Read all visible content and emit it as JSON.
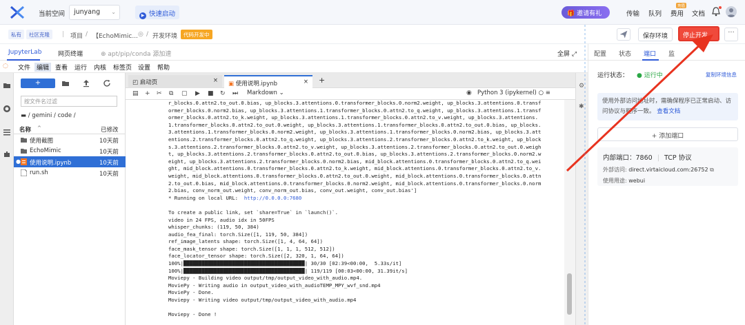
{
  "topbar": {
    "current_space_label": "当前空间",
    "space_value": "junyang",
    "quickstart_label": "快速启动",
    "invite_label": "邀请有礼",
    "nav": [
      "传输",
      "队列",
      "费用",
      "文档"
    ],
    "fee_badge": "充值"
  },
  "breadcrumb": {
    "tag_private": "私有",
    "tag_community": "社区克隆",
    "project": "项目",
    "name": "【EchoMimic...",
    "env": "开发环境",
    "dev_tag": "代码开发中",
    "save_env": "保存环境",
    "stop_dev": "停止开发",
    "more": "···"
  },
  "tabs": {
    "jupyter": "JupyterLab",
    "terminal": "网页终端",
    "conda": "apt/pip/conda 源加速",
    "fullscreen": "全屏"
  },
  "right_panel": {
    "tabs": [
      "配置",
      "状态",
      "端口",
      "监"
    ],
    "run_status_label": "运行状态：",
    "run_status_value": "● 运行中",
    "copy_env": "复制环境信息",
    "info_text": "使用外部访问地址时，需确保程序已正常启动、访问协议与程序一致。",
    "info_link": "查看文档",
    "add_port": "+ 添加端口",
    "port_label": "内部端口：",
    "port_value": "7860",
    "protocol": "TCP 协议",
    "ext_label": "外部访问:",
    "ext_value": "direct.virtaicloud.com:26752",
    "use_label": "使用用途:",
    "use_value": "webui"
  },
  "menubar": [
    "文件",
    "编辑",
    "查看",
    "运行",
    "内核",
    "标签页",
    "设置",
    "帮助"
  ],
  "filebrowser": {
    "filter_placeholder": "按文件名过滤",
    "path": "/ gemini / code /",
    "col_name": "名称",
    "col_modified": "已修改",
    "files": [
      {
        "name": "使用截图",
        "modified": "10天前",
        "type": "folder"
      },
      {
        "name": "EchoMimic",
        "modified": "10天前",
        "type": "folder"
      },
      {
        "name": "使用说明.ipynb",
        "modified": "10天前",
        "type": "notebook"
      },
      {
        "name": "run.sh",
        "modified": "10天前",
        "type": "file"
      }
    ]
  },
  "notebook": {
    "tab1": "启动页",
    "tab2": "使用说明.ipynb",
    "cell_type": "Markdown",
    "kernel": "Python 3 (ipykernel)",
    "output_lines": [
      "r_blocks.0.attn2.to_out.0.bias, up_blocks.3.attentions.0.transformer_blocks.0.norm2.weight, up_blocks.3.attentions.0.transf",
      "ormer_blocks.0.norm2.bias, up_blocks.3.attentions.1.transformer_blocks.0.attn2.to_q.weight, up_blocks.3.attentions.1.transf",
      "ormer_blocks.0.attn2.to_k.weight, up_blocks.3.attentions.1.transformer_blocks.0.attn2.to_v.weight, up_blocks.3.attentions.",
      "1.transformer_blocks.0.attn2.to_out.0.weight, up_blocks.3.attentions.1.transformer_blocks.0.attn2.to_out.0.bias, up_blocks.",
      "3.attentions.1.transformer_blocks.0.norm2.weight, up_blocks.3.attentions.1.transformer_blocks.0.norm2.bias, up_blocks.3.att",
      "entions.2.transformer_blocks.0.attn2.to_q.weight, up_blocks.3.attentions.2.transformer_blocks.0.attn2.to_k.weight, up_block",
      "s.3.attentions.2.transformer_blocks.0.attn2.to_v.weight, up_blocks.3.attentions.2.transformer_blocks.0.attn2.to_out.0.weigh",
      "t, up_blocks.3.attentions.2.transformer_blocks.0.attn2.to_out.0.bias, up_blocks.3.attentions.2.transformer_blocks.0.norm2.w",
      "eight, up_blocks.3.attentions.2.transformer_blocks.0.norm2.bias, mid_block.attentions.0.transformer_blocks.0.attn2.to_q.wei",
      "ght, mid_block.attentions.0.transformer_blocks.0.attn2.to_k.weight, mid_block.attentions.0.transformer_blocks.0.attn2.to_v.",
      "weight, mid_block.attentions.0.transformer_blocks.0.attn2.to_out.0.weight, mid_block.attentions.0.transformer_blocks.0.attn",
      "2.to_out.0.bias, mid_block.attentions.0.transformer_blocks.0.norm2.weight, mid_block.attentions.0.transformer_blocks.0.norm",
      "2.bias, conv_norm_out.weight, conv_norm_out.bias, conv_out.weight, conv_out.bias']"
    ],
    "running_on": "* Running on local URL:  ",
    "running_url": "http://0.0.0.0:7680",
    "output_lines2": [
      "",
      "To create a public link, set `share=True` in `launch()`.",
      "video in 24 FPS, audio idx in 50FPS",
      "whisper_chunks: (119, 50, 384)",
      "audio_fea_final: torch.Size([1, 119, 50, 384])",
      "ref_image_latents shape: torch.Size([1, 4, 64, 64])",
      "face_mask_tensor shape: torch.Size([1, 1, 1, 512, 512])",
      "face_locator_tensor shape: torch.Size([2, 320, 1, 64, 64])",
      "100%|████████████████████████████████████████| 30/30 [02:39<00:00,  5.33s/it]",
      "100%|████████████████████████████████████████| 119/119 [00:03<00:00, 31.39it/s]",
      "Moviepy - Building video output/tmp/output_video_with_audio.mp4.",
      "MoviePy - Writing audio in output_video_with_audioTEMP_MPY_wvf_snd.mp4",
      "MoviePy - Done.",
      "Moviepy - Writing video output/tmp/output_video_with_audio.mp4",
      "",
      "Moviepy - Done !"
    ]
  },
  "colors": {
    "accent": "#2f5bd8",
    "stop_red": "#f04a3b",
    "running_green": "#2aa745",
    "selected_row": "#2f6fd6"
  }
}
